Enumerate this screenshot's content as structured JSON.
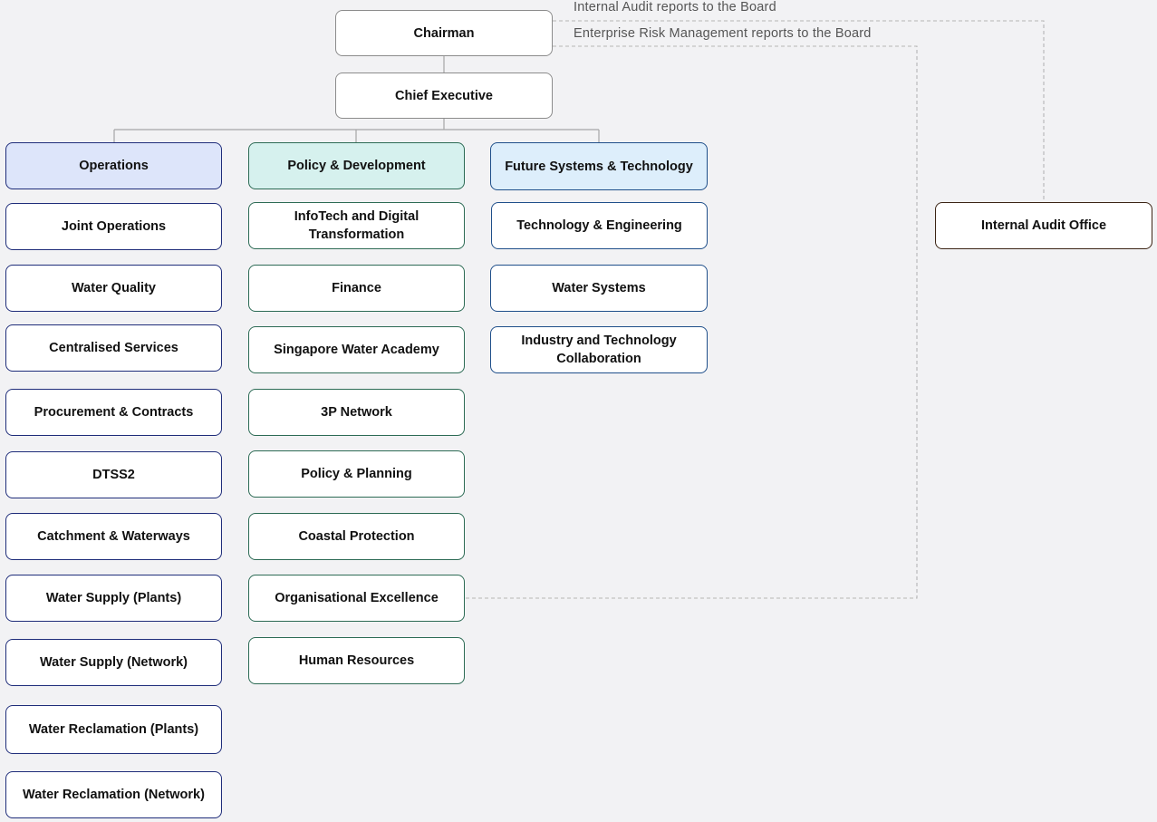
{
  "notes": {
    "internal_audit": "Internal Audit reports to the Board",
    "erm": "Enterprise Risk Management reports to the Board"
  },
  "top": {
    "chairman": "Chairman",
    "chief_executive": "Chief Executive"
  },
  "operations": {
    "header": "Operations",
    "units": [
      "Joint Operations",
      "Water Quality",
      "Centralised Services",
      "Procurement & Contracts",
      "DTSS2",
      "Catchment & Waterways",
      "Water Supply (Plants)",
      "Water Supply (Network)",
      "Water Reclamation (Plants)",
      "Water Reclamation (Network)"
    ]
  },
  "policy_development": {
    "header": "Policy & Development",
    "units": [
      "InfoTech and Digital Transformation",
      "Finance",
      "Singapore Water Academy",
      "3P Network",
      "Policy & Planning",
      "Coastal Protection",
      "Organisational Excellence",
      "Human Resources"
    ]
  },
  "future_systems": {
    "header": "Future Systems & Technology",
    "units": [
      "Technology & Engineering",
      "Water Systems",
      "Industry and Technology Collaboration"
    ]
  },
  "internal_audit_office": "Internal Audit Office",
  "colors": {
    "background": "#f2f2f4",
    "operations_border": "#1f2d7a",
    "operations_header_fill": "#dde5fa",
    "policy_border": "#2d6b55",
    "policy_header_fill": "#d6f1ee",
    "future_border": "#1f4f8a",
    "future_header_fill": "#ddeefb",
    "audit_border": "#3b2414",
    "connector": "#a6a6a6"
  }
}
